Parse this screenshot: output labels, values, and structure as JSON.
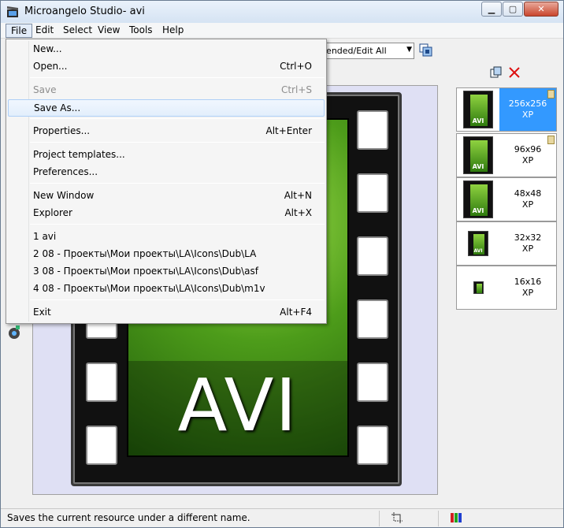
{
  "window": {
    "title": "Microangelo Studio- avi"
  },
  "menubar": {
    "items": [
      "File",
      "Edit",
      "Select",
      "View",
      "Tools",
      "Help"
    ]
  },
  "toolbar": {
    "combo_value": "lended/Edit All"
  },
  "file_menu": [
    {
      "label": "New...",
      "shortcut": ""
    },
    {
      "label": "Open...",
      "shortcut": "Ctrl+O"
    },
    {
      "label": "Save",
      "shortcut": "Ctrl+S",
      "disabled": true
    },
    {
      "label": "Save As...",
      "shortcut": ""
    },
    {
      "label": "Properties...",
      "shortcut": "Alt+Enter"
    },
    {
      "label": "Project templates...",
      "shortcut": ""
    },
    {
      "label": "Preferences...",
      "shortcut": ""
    },
    {
      "label": "New Window",
      "shortcut": "Alt+N"
    },
    {
      "label": "Explorer",
      "shortcut": "Alt+X"
    },
    {
      "label": "1 avi",
      "shortcut": ""
    },
    {
      "label": "2 08 - Проекты\\Мои проекты\\LA\\Icons\\Dub\\LA",
      "shortcut": ""
    },
    {
      "label": "3 08 - Проекты\\Мои проекты\\LA\\Icons\\Dub\\asf",
      "shortcut": ""
    },
    {
      "label": "4 08 - Проекты\\Мои проекты\\LA\\Icons\\Dub\\m1v",
      "shortcut": ""
    },
    {
      "label": "Exit",
      "shortcut": "Alt+F4"
    }
  ],
  "canvas": {
    "icon_text": "AVI"
  },
  "sizes": [
    {
      "size": "256x256",
      "format": "XP",
      "selected": true
    },
    {
      "size": "96x96",
      "format": "XP"
    },
    {
      "size": "48x48",
      "format": "XP"
    },
    {
      "size": "32x32",
      "format": "XP"
    },
    {
      "size": "16x16",
      "format": "XP"
    }
  ],
  "statusbar": {
    "text": "Saves the current resource under a different name."
  },
  "colors": {
    "selection": "#3399ff",
    "menu_hover": "#e2eefc"
  }
}
